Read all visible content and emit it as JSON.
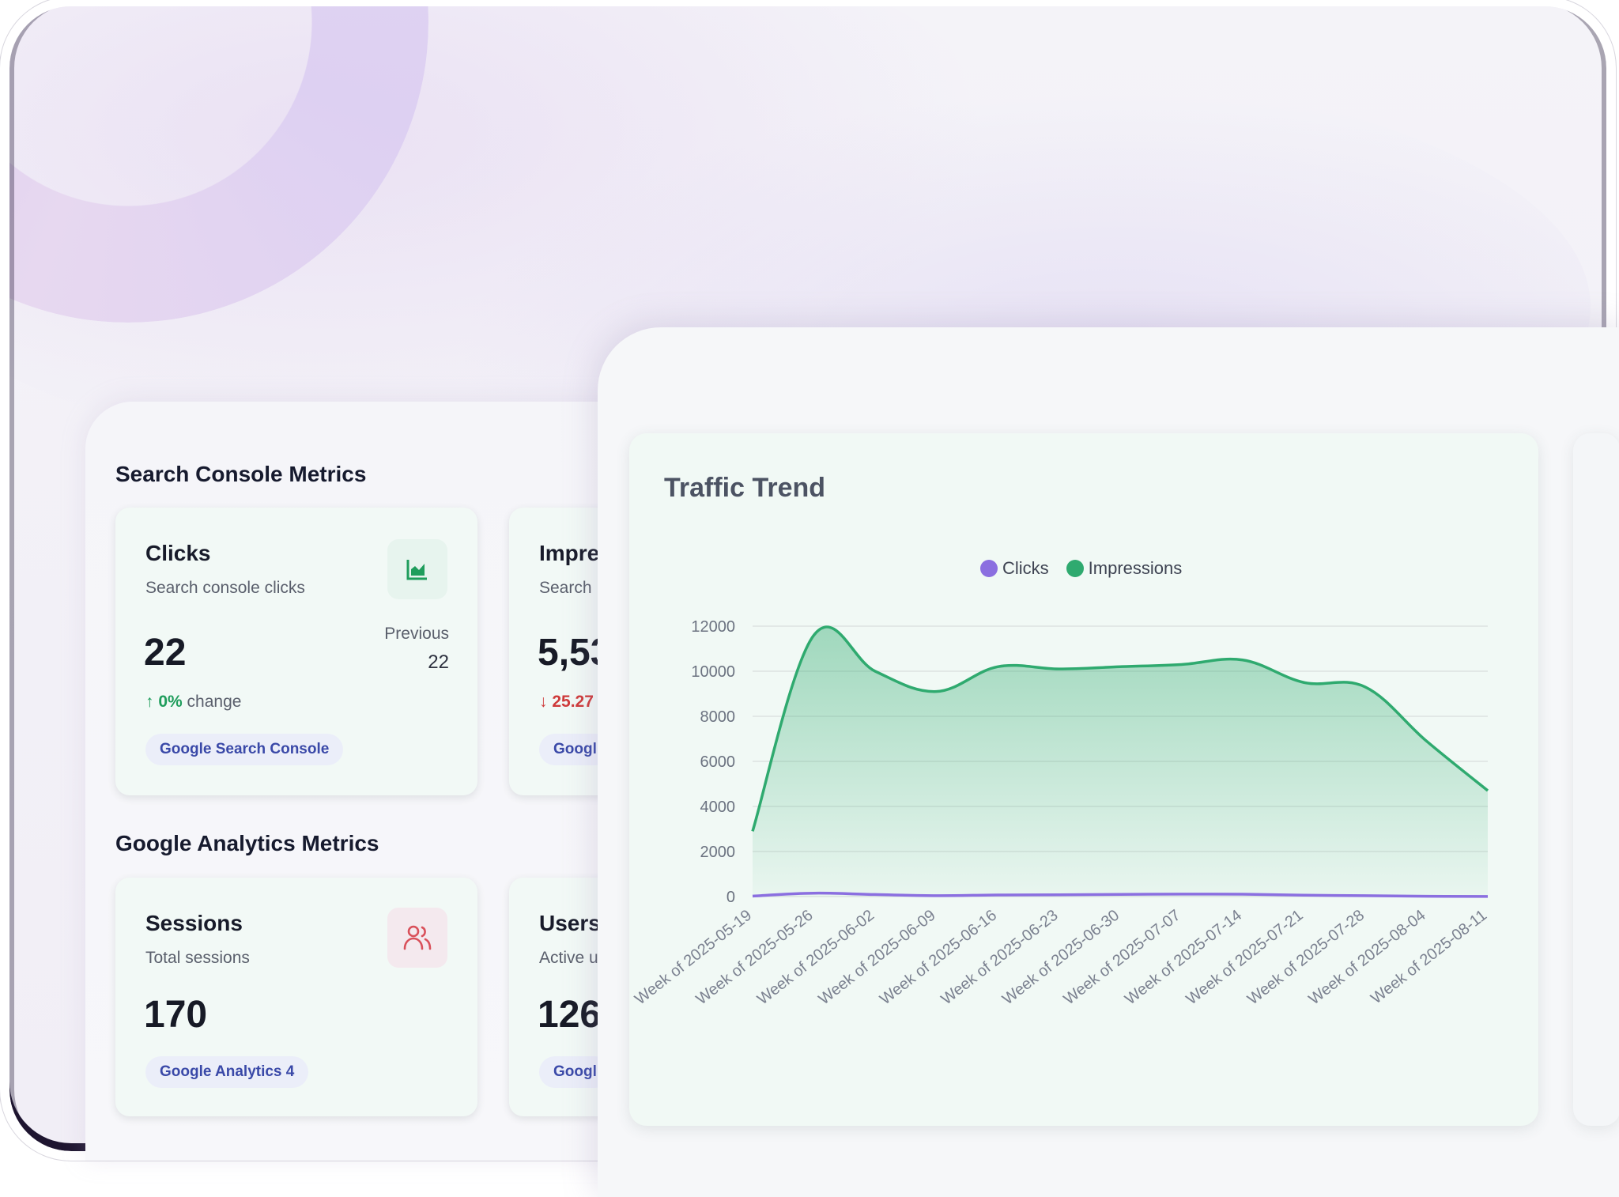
{
  "search_console": {
    "section_title": "Search Console Metrics",
    "clicks_card": {
      "title": "Clicks",
      "subtitle": "Search console clicks",
      "value": "22",
      "previous_label": "Previous",
      "previous_value": "22",
      "change_arrow": "↑",
      "change_value": "0%",
      "change_suffix": "change",
      "badge": "Google Search Console",
      "icon": "area-chart-icon",
      "icon_color": "#1f9d5c"
    },
    "impressions_card": {
      "title": "Impre",
      "subtitle": "Search",
      "value": "5,53",
      "change_arrow": "↓",
      "change_value": "25.27",
      "badge": "Googl"
    }
  },
  "analytics": {
    "section_title": "Google Analytics Metrics",
    "sessions_card": {
      "title": "Sessions",
      "subtitle": "Total sessions",
      "value": "170",
      "badge": "Google Analytics 4",
      "icon": "users-icon",
      "icon_color": "#d9505a"
    },
    "users_card": {
      "title": "Users",
      "subtitle": "Active u",
      "value": "126",
      "badge": "Googl"
    }
  },
  "chart_data": {
    "type": "area",
    "title": "Traffic Trend",
    "legend_position": "top",
    "grid": true,
    "ylim": [
      0,
      12000
    ],
    "y_ticks": [
      "0",
      "2000",
      "4000",
      "6000",
      "8000",
      "10000",
      "12000"
    ],
    "categories": [
      "Week of 2025-05-19",
      "Week of 2025-05-26",
      "Week of 2025-06-02",
      "Week of 2025-06-09",
      "Week of 2025-06-16",
      "Week of 2025-06-23",
      "Week of 2025-06-30",
      "Week of 2025-07-07",
      "Week of 2025-07-14",
      "Week of 2025-07-21",
      "Week of 2025-07-28",
      "Week of 2025-08-04",
      "Week of 2025-08-11"
    ],
    "series": [
      {
        "name": "Clicks",
        "color": "#8b6fe0",
        "values": [
          22,
          150,
          90,
          40,
          70,
          80,
          95,
          110,
          105,
          60,
          40,
          15,
          5
        ]
      },
      {
        "name": "Impressions",
        "color": "#2faa6f",
        "values": [
          2900,
          11600,
          10000,
          9100,
          10200,
          10100,
          10200,
          10300,
          10500,
          9500,
          9300,
          6900,
          4700
        ]
      }
    ]
  }
}
